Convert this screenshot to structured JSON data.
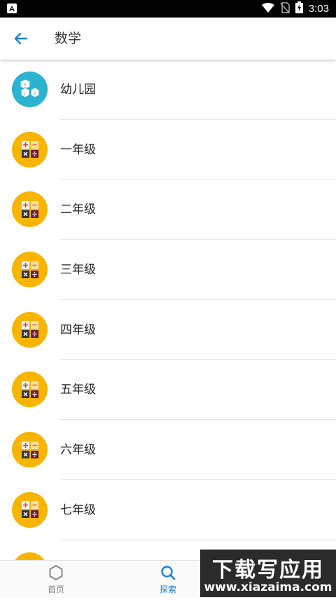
{
  "status_bar": {
    "time": "3:03"
  },
  "app_bar": {
    "title": "数学",
    "back_icon": "arrow-left-icon"
  },
  "list": {
    "items": [
      {
        "label": "幼儿园",
        "icon": "blocks-icon"
      },
      {
        "label": "一年级",
        "icon": "calculator-icon"
      },
      {
        "label": "二年级",
        "icon": "calculator-icon"
      },
      {
        "label": "三年级",
        "icon": "calculator-icon"
      },
      {
        "label": "四年级",
        "icon": "calculator-icon"
      },
      {
        "label": "五年级",
        "icon": "calculator-icon"
      },
      {
        "label": "六年级",
        "icon": "calculator-icon"
      },
      {
        "label": "七年级",
        "icon": "calculator-icon"
      },
      {
        "label": "",
        "icon": "calculator-icon"
      }
    ]
  },
  "bottom_nav": {
    "items": [
      {
        "label": "首页",
        "icon": "hexagon-icon",
        "active": false
      },
      {
        "label": "探索",
        "icon": "search-icon",
        "active": true
      }
    ],
    "active_color": "#1a7fd4",
    "inactive_color": "#8a8a8a"
  },
  "watermark": {
    "title": "下载写应用",
    "url": "www.xiazaima.com"
  },
  "colors": {
    "teal": "#2bb3d0",
    "yellow": "#f7b500",
    "accent": "#1a7fd4"
  }
}
